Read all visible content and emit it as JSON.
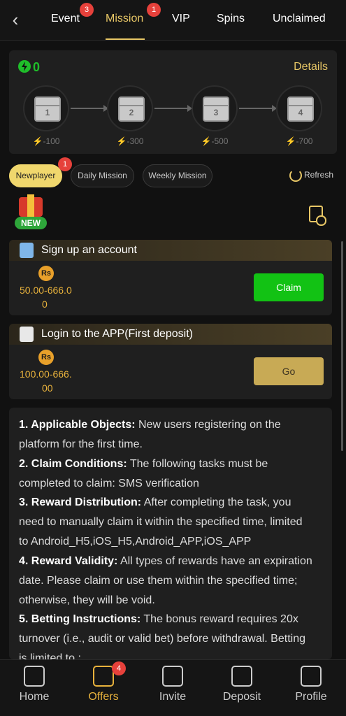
{
  "tabs": [
    {
      "label": "Event",
      "badge": "3"
    },
    {
      "label": "Mission",
      "badge": "1"
    },
    {
      "label": "VIP"
    },
    {
      "label": "Spins"
    },
    {
      "label": "Unclaimed"
    }
  ],
  "progress": {
    "count": "0",
    "details_label": "Details",
    "chests": [
      {
        "number": "1",
        "score": "-100"
      },
      {
        "number": "2",
        "score": "-300"
      },
      {
        "number": "3",
        "score": "-500"
      },
      {
        "number": "4",
        "score": "-700"
      }
    ]
  },
  "filters": [
    {
      "label": "Newplayer",
      "badge": "1"
    },
    {
      "label": "Daily Mission"
    },
    {
      "label": "Weekly Mission"
    }
  ],
  "refresh_label": "Refresh",
  "new_tag": "NEW",
  "tasks": [
    {
      "title": "Sign up an account",
      "currency": "Rs",
      "reward_line1": "50.00-666.0",
      "reward_line2": "0",
      "button": "Claim"
    },
    {
      "title": "Login to the APP(First deposit)",
      "currency": "Rs",
      "reward_line1": "100.00-666.",
      "reward_line2": "00",
      "button": "Go"
    }
  ],
  "rules": [
    {
      "head": "1. Applicable Objects:",
      "text": " New users registering on the platform for the first time."
    },
    {
      "head": "2. Claim Conditions:",
      "text": " The following tasks must be completed to claim: SMS verification"
    },
    {
      "head": "3. Reward Distribution:",
      "text": " After completing the task, you need to manually claim it within the specified time, limited to Android_H5,iOS_H5,Android_APP,iOS_APP"
    },
    {
      "head": "4. Reward Validity:",
      "text": " All types of rewards have an expiration date. Please claim or use them within the specified time; otherwise, they will be void."
    },
    {
      "head": "5. Betting Instructions:",
      "text": " The bonus reward requires 20x turnover (i.e., audit or valid bet) before withdrawal. Betting is limited to :"
    }
  ],
  "bottom_nav": [
    {
      "label": "Home"
    },
    {
      "label": "Offers",
      "badge": "4"
    },
    {
      "label": "Invite"
    },
    {
      "label": "Deposit"
    },
    {
      "label": "Profile"
    }
  ]
}
